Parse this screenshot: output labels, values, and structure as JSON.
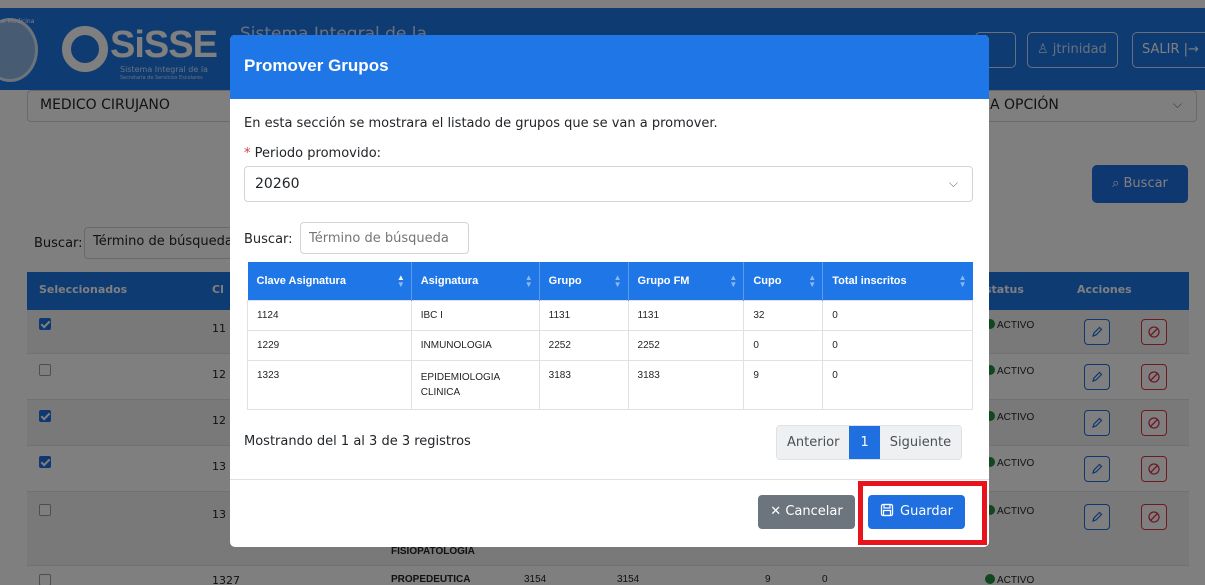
{
  "header": {
    "seal_text": "e Medicina",
    "logo_text": "SiSSE",
    "logo_subtitle": "Sistema Integral de la",
    "logo_tagline": "Secretaría de Servicios Escolares",
    "app_title": "Sistema Integral de la",
    "user_button": "jtrinidad",
    "exit_button": "SALIR"
  },
  "background": {
    "career_select": "MEDICO CIRUJANO",
    "option_select": "A OPCIÓN",
    "search_button": "Buscar",
    "search_label": "Buscar:",
    "search_placeholder": "Término de búsqueda",
    "columns": {
      "selected": "Seleccionados",
      "clave_partial": "Cl",
      "status": "status",
      "actions": "Acciones"
    },
    "rows": [
      {
        "clave": "11",
        "status": "ACTIVO"
      },
      {
        "clave": "12",
        "status": "ACTIVO"
      },
      {
        "clave": "12",
        "status": "ACTIVO"
      },
      {
        "clave": "13",
        "status": "ACTIVO"
      },
      {
        "clave": "13",
        "status": "ACTIVO"
      },
      {
        "clave": "1327",
        "status": "ACTIVO"
      }
    ],
    "row5_subject_partial": "FISIOPATOLOGIA",
    "row6_subject_partial": "PROPEDEUTICA",
    "row6_grupo": "3154",
    "row6_grupo_fm": "3154",
    "row6_cupo": "9",
    "row6_inscritos": "0"
  },
  "modal": {
    "title": "Promover Grupos",
    "description": "En esta sección se mostrara el listado de grupos que se van a promover.",
    "period_label": "Periodo promovido:",
    "period_value": "20260",
    "search_label": "Buscar:",
    "search_placeholder": "Término de búsqueda",
    "columns": [
      "Clave Asignatura",
      "Asignatura",
      "Grupo",
      "Grupo FM",
      "Cupo",
      "Total inscritos"
    ],
    "rows": [
      {
        "clave": "1124",
        "asignatura": "IBC I",
        "grupo": "1131",
        "grupo_fm": "1131",
        "cupo": "32",
        "inscritos": "0"
      },
      {
        "clave": "1229",
        "asignatura": "INMUNOLOGIA",
        "grupo": "2252",
        "grupo_fm": "2252",
        "cupo": "0",
        "inscritos": "0"
      },
      {
        "clave": "1323",
        "asignatura": "EPIDEMIOLOGIA CLINICA",
        "grupo": "3183",
        "grupo_fm": "3183",
        "cupo": "9",
        "inscritos": "0"
      }
    ],
    "info": "Mostrando del 1 al 3 de 3 registros",
    "pagination": {
      "prev": "Anterior",
      "current": "1",
      "next": "Siguiente"
    },
    "cancel_button": "Cancelar",
    "save_button": "Guardar"
  },
  "colors": {
    "primary": "#1f76e6",
    "danger": "#dc3545",
    "secondary": "#6c757d",
    "highlight": "#e8131b"
  }
}
